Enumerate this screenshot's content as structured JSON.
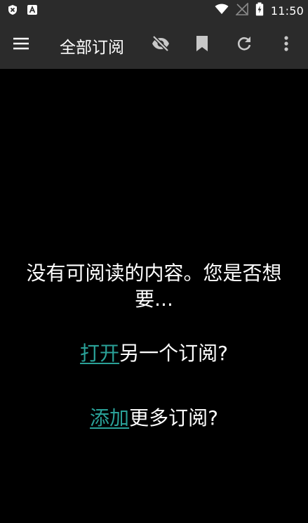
{
  "status_bar": {
    "time": "11:50",
    "left_icons": [
      "shield-x-icon",
      "font-a-icon"
    ],
    "right_icons": [
      "wifi-icon",
      "signal-off-icon",
      "battery-charging-icon"
    ]
  },
  "toolbar": {
    "title": "全部订阅",
    "icons": [
      "menu-icon",
      "eye-off-icon",
      "bookmark-icon",
      "refresh-icon",
      "more-vert-icon"
    ]
  },
  "content": {
    "empty_message": "没有可阅读的内容。您是否想要...",
    "open_link": "打开",
    "open_rest": "另一个订阅?",
    "add_link": "添加",
    "add_rest": "更多订阅?"
  },
  "colors": {
    "background": "#000000",
    "bar": "#2b2b2b",
    "text": "#ffffff",
    "link": "#2aa198"
  }
}
